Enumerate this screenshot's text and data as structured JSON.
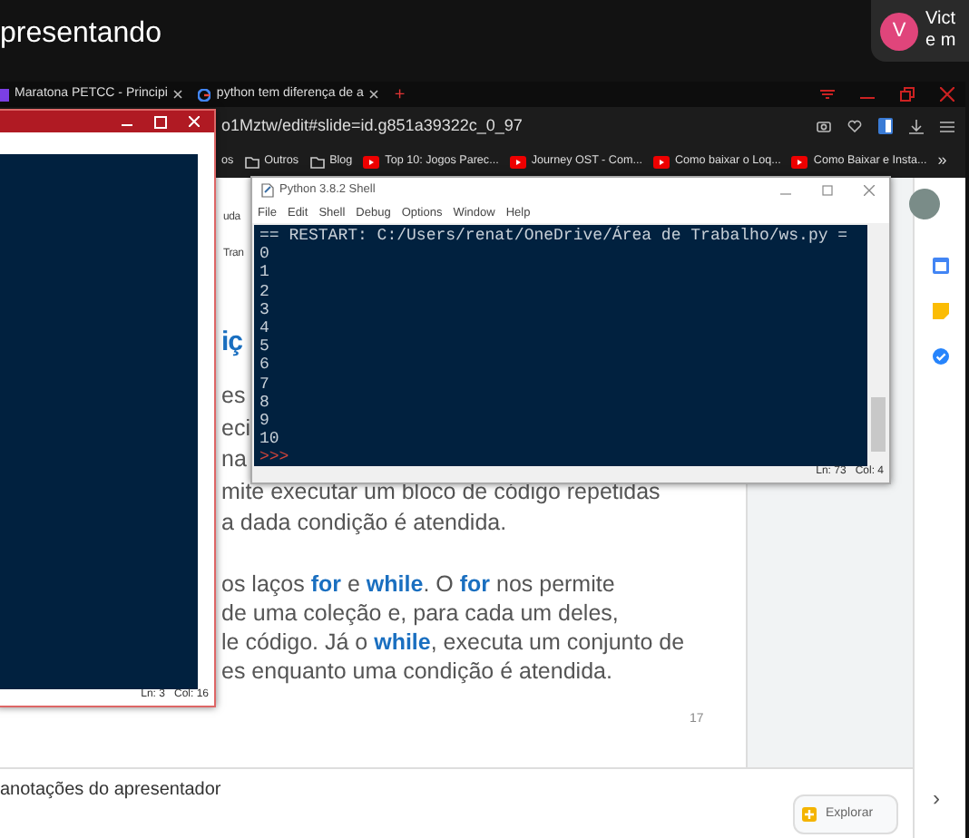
{
  "meeting": {
    "title": "presentando",
    "notification": {
      "avatar_letter": "V",
      "lines": [
        "Vict",
        "e m"
      ]
    }
  },
  "browser": {
    "tabs": [
      {
        "label": "Maratona PETCC - Principi",
        "kind": "slides"
      },
      {
        "label": "python tem diferença de a",
        "kind": "google"
      }
    ],
    "new_tab": "+",
    "url": "o1Mztw/edit#slide=id.g851a39322c_0_97",
    "bookmarks": [
      {
        "label": "os",
        "kind": "plain"
      },
      {
        "label": "Outros",
        "kind": "folder"
      },
      {
        "label": "Blog",
        "kind": "folder"
      },
      {
        "label": "Top 10: Jogos Parec...",
        "kind": "video"
      },
      {
        "label": "Journey OST - Com...",
        "kind": "video"
      },
      {
        "label": "Como baixar o Loq...",
        "kind": "video"
      },
      {
        "label": "Como Baixar e Insta...",
        "kind": "video"
      }
    ],
    "overflow": "»"
  },
  "slides": {
    "side_labels": [
      "uda",
      "Tran"
    ],
    "heading": "iç",
    "paragraphs": [
      [
        "es",
        "eci",
        "na",
        "mite executar um bloco de código repetidas",
        "a dada condição é atendida."
      ],
      [
        "os laços **for** e **while**. O **for** nos permite",
        "de uma coleção e, para cada um deles,",
        "le código. Já o **while**, executa um conjunto de",
        "es enquanto uma condição é atendida."
      ]
    ],
    "page_number": "17",
    "notes": "anotações do apresentador",
    "explore_button": "Explorar",
    "next": "›"
  },
  "editor_window": {
    "status": [
      "Ln: 3",
      "Col: 16"
    ]
  },
  "shell": {
    "title": "Python 3.8.2 Shell",
    "menu": [
      "File",
      "Edit",
      "Shell",
      "Debug",
      "Options",
      "Window",
      "Help"
    ],
    "lines": [
      {
        "text": "== RESTART: C:/Users/renat/OneDrive/Área de Trabalho/ws.py =",
        "kind": "output"
      },
      {
        "text": "0",
        "kind": "output"
      },
      {
        "text": "1",
        "kind": "output"
      },
      {
        "text": "2",
        "kind": "output"
      },
      {
        "text": "3",
        "kind": "output"
      },
      {
        "text": "4",
        "kind": "output"
      },
      {
        "text": "5",
        "kind": "output"
      },
      {
        "text": "6",
        "kind": "output"
      },
      {
        "text": "7",
        "kind": "output"
      },
      {
        "text": "8",
        "kind": "output"
      },
      {
        "text": "9",
        "kind": "output"
      },
      {
        "text": "10",
        "kind": "output"
      },
      {
        "text": ">>>",
        "kind": "prompt"
      }
    ],
    "status": [
      "Ln: 73",
      "Col: 4"
    ]
  }
}
